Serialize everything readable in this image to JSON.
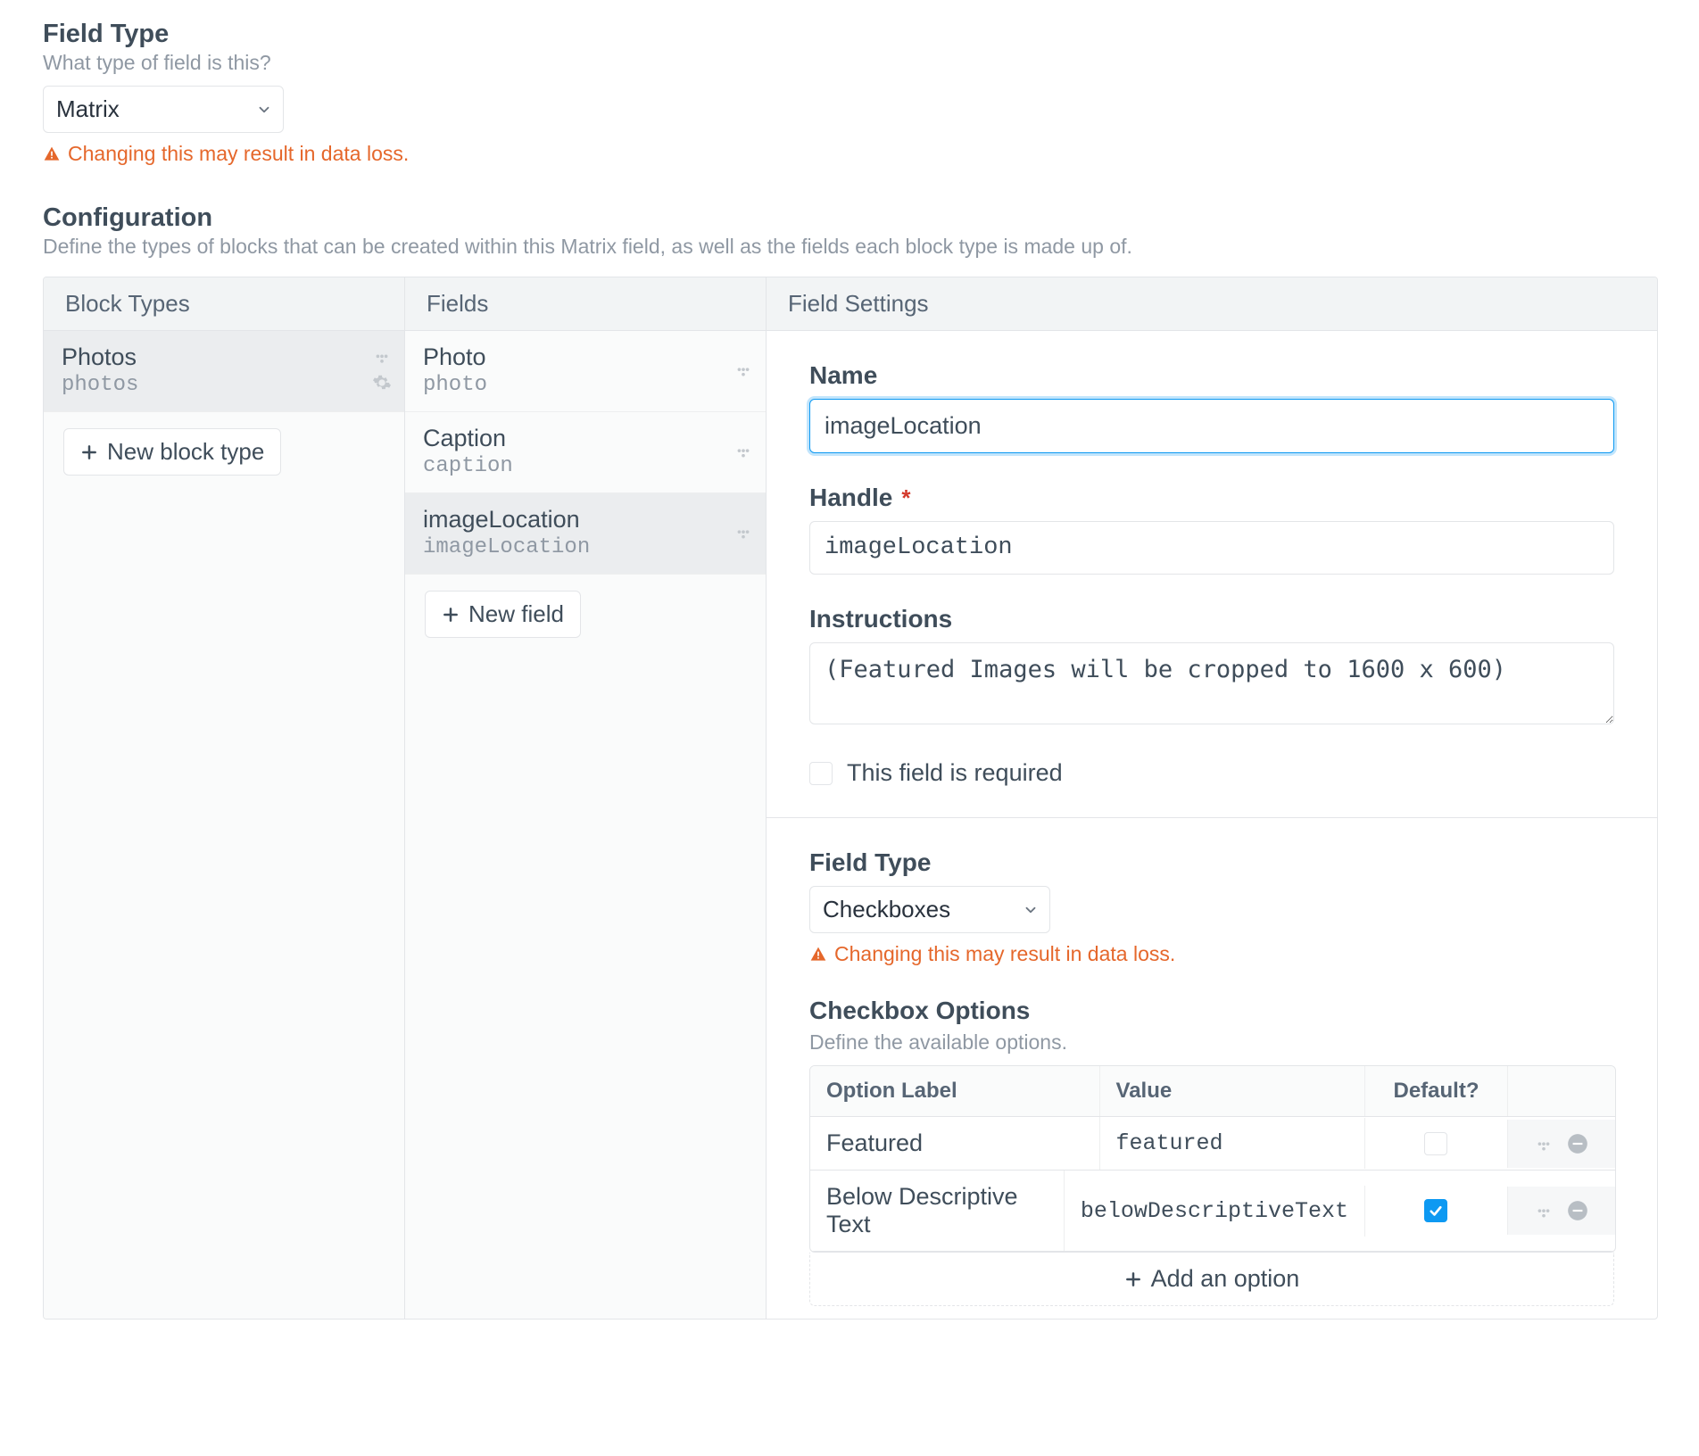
{
  "top": {
    "fieldType": {
      "heading": "Field Type",
      "sub": "What type of field is this?",
      "value": "Matrix",
      "warning": "Changing this may result in data loss."
    }
  },
  "config": {
    "heading": "Configuration",
    "sub": "Define the types of blocks that can be created within this Matrix field, as well as the fields each block type is made up of.",
    "cols": {
      "blockTypes": "Block Types",
      "fields": "Fields",
      "settings": "Field Settings"
    },
    "blockTypes": [
      {
        "label": "Photos",
        "handle": "photos",
        "selected": true
      }
    ],
    "newBlockType": "New block type",
    "fields": [
      {
        "label": "Photo",
        "handle": "photo",
        "selected": false
      },
      {
        "label": "Caption",
        "handle": "caption",
        "selected": false
      },
      {
        "label": "imageLocation",
        "handle": "imageLocation",
        "selected": true
      }
    ],
    "newField": "New field"
  },
  "settings": {
    "name": {
      "label": "Name",
      "value": "imageLocation"
    },
    "handle": {
      "label": "Handle",
      "value": "imageLocation",
      "required": true
    },
    "instructions": {
      "label": "Instructions",
      "value": "(Featured Images will be cropped to 1600 x 600)"
    },
    "requiredCheckbox": {
      "label": "This field is required",
      "checked": false
    },
    "fieldType": {
      "label": "Field Type",
      "value": "Checkboxes",
      "warning": "Changing this may result in data loss."
    },
    "checkboxOptions": {
      "heading": "Checkbox Options",
      "sub": "Define the available options.",
      "cols": {
        "label": "Option Label",
        "value": "Value",
        "default": "Default?"
      },
      "rows": [
        {
          "label": "Featured",
          "value": "featured",
          "default": false
        },
        {
          "label": "Below Descriptive Text",
          "value": "belowDescriptiveText",
          "default": true
        }
      ],
      "addOption": "Add an option"
    }
  }
}
